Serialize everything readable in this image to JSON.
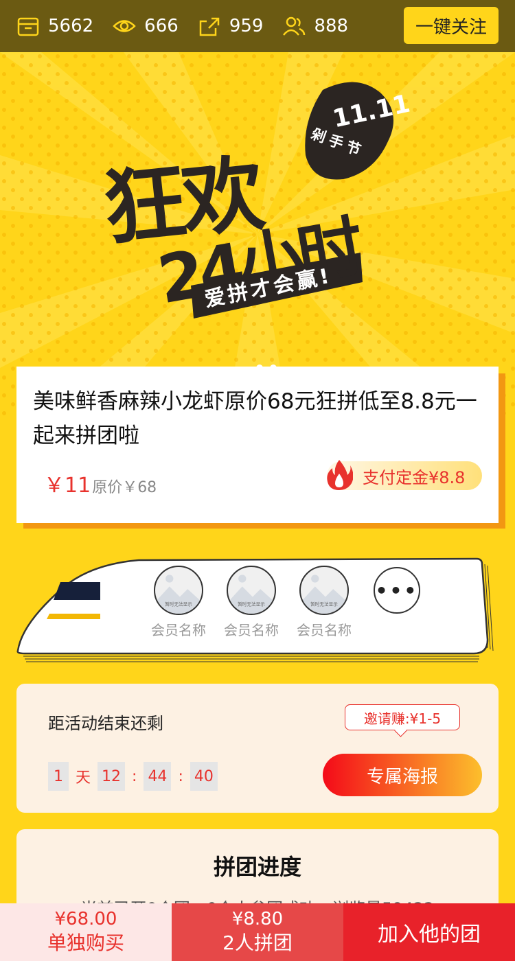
{
  "stats": {
    "items": [
      {
        "icon": "shop-icon",
        "value": "5662"
      },
      {
        "icon": "eye-icon",
        "value": "666"
      },
      {
        "icon": "share-icon",
        "value": "959"
      },
      {
        "icon": "users-icon",
        "value": "888"
      }
    ],
    "follow_label": "一键关注"
  },
  "banner": {
    "headline_line1": "狂欢",
    "headline_line2": "24小时",
    "badge_date": "11.11",
    "badge_label": "剁手节",
    "slogan": "爱拼才会赢!"
  },
  "product": {
    "title": "美味鲜香麻辣小龙虾原价68元狂拼低至8.8元一起来拼团啦",
    "price_now": "￥11",
    "price_original": "原价￥68",
    "deposit_label": "支付定金¥8.8"
  },
  "members": {
    "items": [
      {
        "name": "会员名称",
        "placeholder": "暂时无法显示"
      },
      {
        "name": "会员名称",
        "placeholder": "暂时无法显示"
      },
      {
        "name": "会员名称",
        "placeholder": "暂时无法显示"
      }
    ],
    "more_label": "•••"
  },
  "countdown": {
    "label": "距活动结束还剩",
    "invite_badge": "邀请赚:¥1-5",
    "days": "1",
    "day_unit": "天",
    "hours": "12",
    "minutes": "44",
    "seconds": "40",
    "separator": ":",
    "poster_button": "专属海报"
  },
  "progress": {
    "title": "拼团进度",
    "stats_text": "当前已开0个团，0个人参团成功，浏览量59422"
  },
  "actions": {
    "single": {
      "price": "¥68.00",
      "label": "单独购买"
    },
    "group": {
      "price": "¥8.80",
      "label": "2人拼团"
    },
    "join_label": "加入他的团"
  },
  "colors": {
    "brand_yellow": "#ffd51a",
    "accent_red": "#e8322d",
    "dark_bar": "#6b5a12"
  }
}
